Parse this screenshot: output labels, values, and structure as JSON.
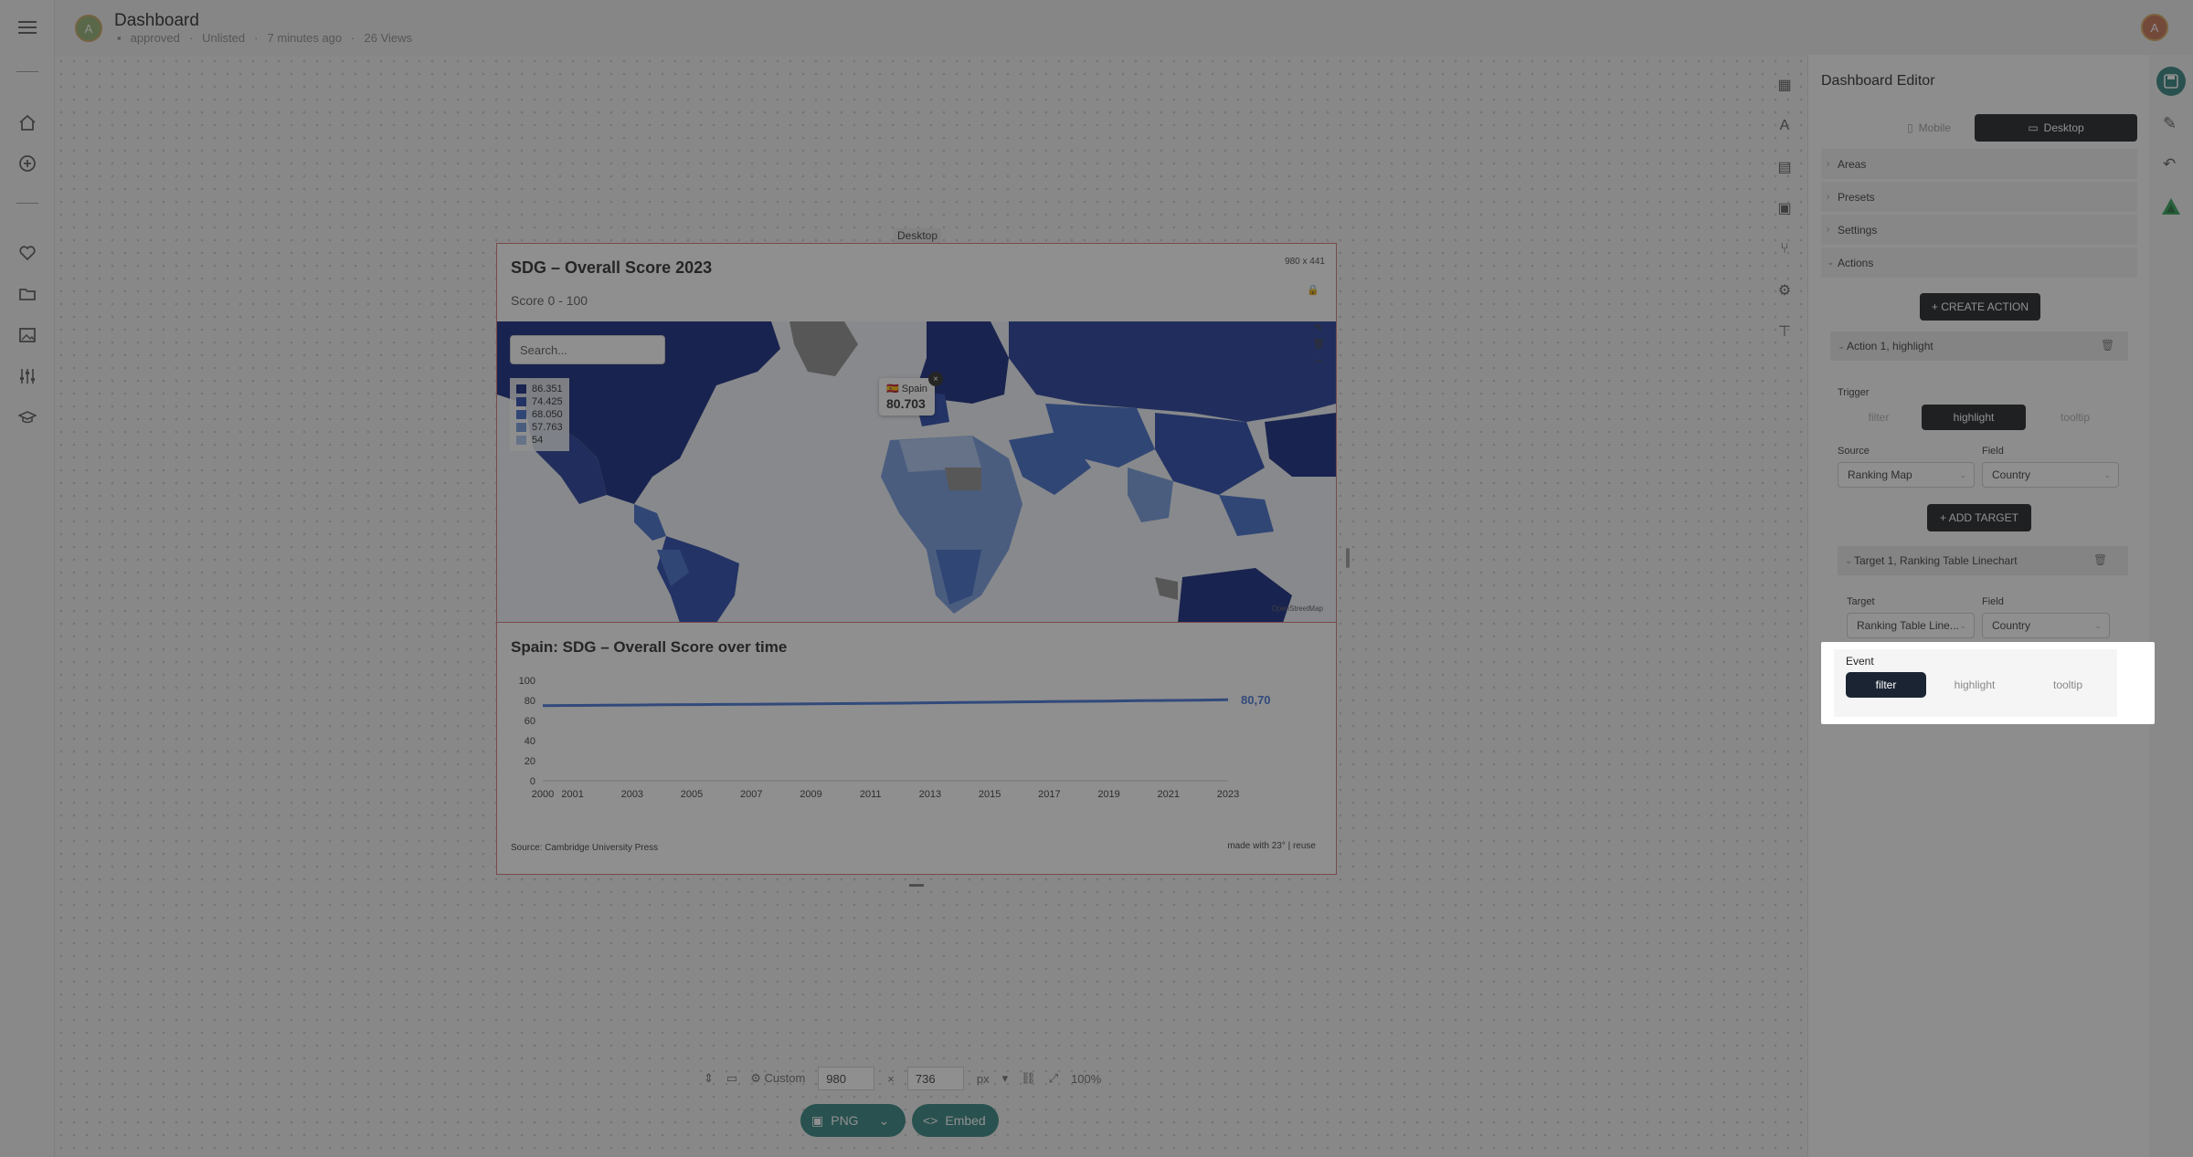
{
  "header": {
    "title": "Dashboard",
    "avatar_letter": "A",
    "status": "approved",
    "visibility": "Unlisted",
    "edited": "7 minutes ago",
    "views": "26 Views",
    "user_initial": "A"
  },
  "left_rail": {
    "icons": [
      "menu-icon",
      "home-icon",
      "add-circle-icon",
      "heart-icon",
      "folder-icon",
      "image-icon",
      "sliders-icon",
      "graduation-icon"
    ]
  },
  "canvas": {
    "device_tag": "Desktop",
    "size_badge": "980 x 441",
    "widget_title": "SDG – Overall Score 2023",
    "widget_subtitle": "Score 0 - 100",
    "search_placeholder": "Search...",
    "legend": [
      {
        "label": "86.351",
        "color": "#0a1f7a"
      },
      {
        "label": "74.425",
        "color": "#1f3fa8"
      },
      {
        "label": "68.050",
        "color": "#3a66c8"
      },
      {
        "label": "57.763",
        "color": "#6f97dd"
      },
      {
        "label": "54",
        "color": "#a7c2ee"
      }
    ],
    "tooltip": {
      "flag": "🇪🇸",
      "country": "Spain",
      "value": "80.703"
    },
    "tooltip_close": "×",
    "map_credit": "OpenStreetMap",
    "linechart_title": "Spain: SDG – Overall Score over time",
    "source": "Source: Cambridge University Press",
    "made_with": "made with 23° | reuse"
  },
  "chart_data": {
    "type": "line",
    "title": "Spain: SDG – Overall Score over time",
    "xlabel": "",
    "ylabel": "",
    "ylim": [
      0,
      100
    ],
    "y_ticks": [
      0,
      20,
      40,
      60,
      80,
      100
    ],
    "x_ticks": [
      "2000",
      "2001",
      "2003",
      "2005",
      "2007",
      "2009",
      "2011",
      "2013",
      "2015",
      "2017",
      "2019",
      "2021",
      "2023"
    ],
    "x": [
      2000,
      2001,
      2002,
      2003,
      2004,
      2005,
      2006,
      2007,
      2008,
      2009,
      2010,
      2011,
      2012,
      2013,
      2014,
      2015,
      2016,
      2017,
      2018,
      2019,
      2020,
      2021,
      2022,
      2023
    ],
    "series": [
      {
        "values": [
          74.8,
          75.0,
          75.2,
          75.4,
          75.6,
          75.8,
          76.0,
          76.2,
          76.4,
          76.6,
          76.8,
          77.0,
          77.3,
          77.6,
          77.9,
          78.2,
          78.5,
          78.8,
          79.1,
          79.4,
          79.7,
          80.0,
          80.3,
          80.7
        ],
        "color": "#3d6fd6"
      }
    ],
    "end_label": "80,70",
    "grid": false,
    "accent": "#3d6fd6"
  },
  "bottom_bar": {
    "preset": "Custom",
    "width": "980",
    "times": "×",
    "height": "736",
    "unit": "px",
    "zoom": "100%",
    "png_label": "PNG",
    "embed_label": "Embed"
  },
  "right_rail": {
    "icons": [
      "layout-icon",
      "text-icon",
      "table-icon",
      "image-icon",
      "branch-icon",
      "gear-icon",
      "paint-roller-icon"
    ]
  },
  "editor": {
    "title": "Dashboard Editor",
    "mobile_label": "Mobile",
    "desktop_label": "Desktop",
    "sections": [
      "Areas",
      "Presets",
      "Settings",
      "Actions"
    ],
    "create_action": "+ CREATE ACTION",
    "action_title": "Action 1, highlight",
    "trigger_label": "Trigger",
    "trigger_options": [
      "filter",
      "highlight",
      "tooltip"
    ],
    "trigger_selected": "highlight",
    "source_label": "Source",
    "source_value": "Ranking Map",
    "field_label": "Field",
    "field_value": "Country",
    "add_target": "+ ADD TARGET",
    "target_title": "Target 1, Ranking Table Linechart",
    "target_label": "Target",
    "target_value": "Ranking Table Line...",
    "target_field_label": "Field",
    "target_field_value": "Country",
    "event_label": "Event",
    "event_options": [
      "filter",
      "highlight",
      "tooltip"
    ],
    "event_selected": "filter"
  },
  "colors": {
    "accent_teal": "#2a7d7a",
    "map_dark": "#0a1f7a",
    "dark_button": "#15181d"
  }
}
